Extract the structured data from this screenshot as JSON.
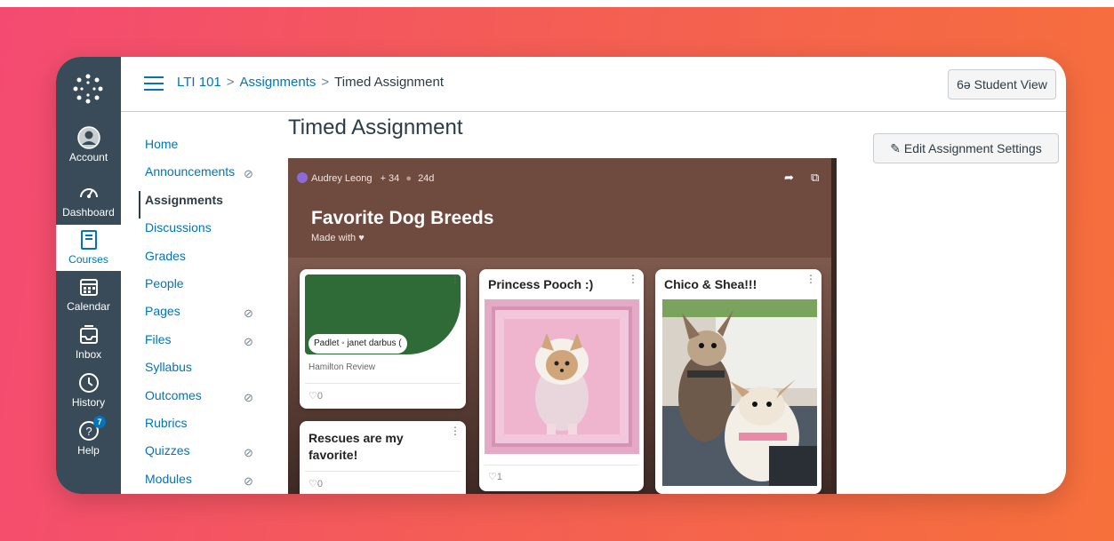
{
  "global_nav": {
    "items": [
      {
        "label": "Account",
        "icon": "user-circle-icon"
      },
      {
        "label": "Dashboard",
        "icon": "dashboard-icon"
      },
      {
        "label": "Courses",
        "icon": "book-icon",
        "active": true
      },
      {
        "label": "Calendar",
        "icon": "calendar-icon"
      },
      {
        "label": "Inbox",
        "icon": "inbox-icon"
      },
      {
        "label": "History",
        "icon": "clock-icon"
      },
      {
        "label": "Help",
        "icon": "help-icon",
        "badge": "7"
      }
    ]
  },
  "header": {
    "breadcrumb": [
      "LTI 101",
      "Assignments",
      "Timed Assignment"
    ],
    "separator": ">",
    "student_view_label": "6ə Student View"
  },
  "course_nav": {
    "items": [
      {
        "label": "Home",
        "hidden": false
      },
      {
        "label": "Announcements",
        "hidden": true
      },
      {
        "label": "Assignments",
        "hidden": false,
        "active": true
      },
      {
        "label": "Discussions",
        "hidden": false
      },
      {
        "label": "Grades",
        "hidden": false
      },
      {
        "label": "People",
        "hidden": false
      },
      {
        "label": "Pages",
        "hidden": true
      },
      {
        "label": "Files",
        "hidden": true
      },
      {
        "label": "Syllabus",
        "hidden": false
      },
      {
        "label": "Outcomes",
        "hidden": true
      },
      {
        "label": "Rubrics",
        "hidden": false
      },
      {
        "label": "Quizzes",
        "hidden": true
      },
      {
        "label": "Modules",
        "hidden": true
      }
    ]
  },
  "main": {
    "page_title": "Timed Assignment",
    "edit_settings_label": "Edit Assignment Settings"
  },
  "padlet": {
    "author": "Audrey Leong",
    "karma": "+ 34",
    "age": "24d",
    "title": "Favorite Dog Breeds",
    "subtitle": "Made with ♥",
    "cards": [
      {
        "title": "",
        "link_chip": "Padlet ◦ janet darbus (",
        "link_source": "Hamilton Review",
        "likes": "♡0"
      },
      {
        "title": "Princess Pooch :)",
        "likes": "♡1"
      },
      {
        "title": "Chico & Shea!!!",
        "likes": ""
      },
      {
        "title": "Rescues are my favorite!",
        "likes": "♡0"
      }
    ]
  },
  "colors": {
    "canvas_nav": "#394b58",
    "link_blue": "#0374b5",
    "padlet_brown": "#6f4a3f"
  }
}
